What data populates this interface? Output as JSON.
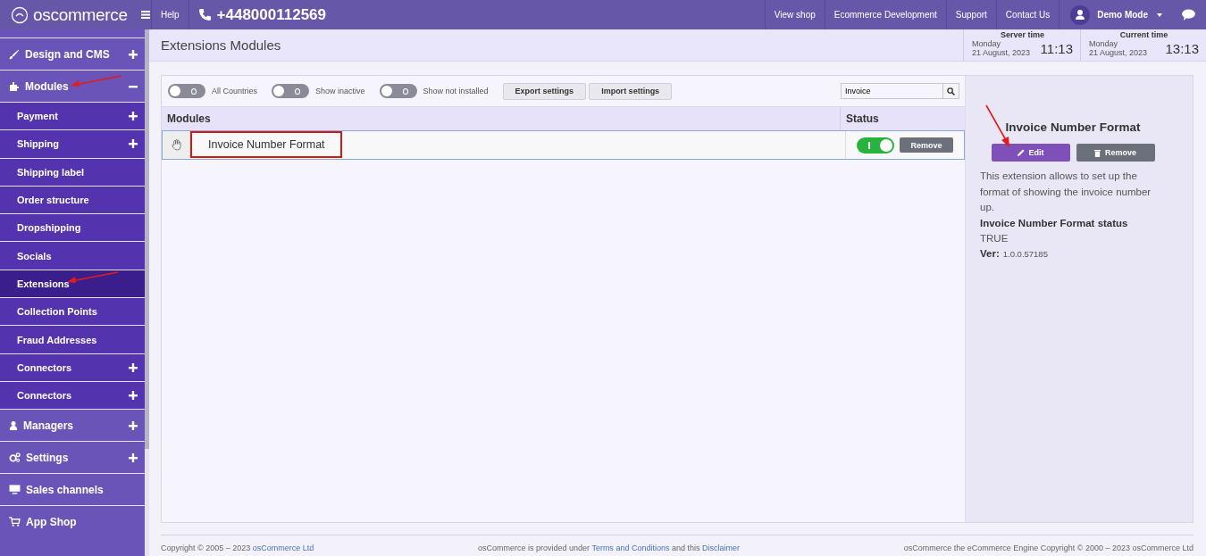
{
  "topbar": {
    "logo": "oscommerce",
    "help": "Help",
    "phone": "+448000112569",
    "links": [
      "View shop",
      "Ecommerce Development",
      "Support",
      "Contact Us"
    ],
    "user": "Demo Mode"
  },
  "sidebar": {
    "items": [
      {
        "label": "Design and CMS",
        "kind": "section",
        "expanded": false,
        "selected": false,
        "pointer_arrow": false
      },
      {
        "label": "Modules",
        "kind": "section",
        "expanded": true,
        "selected": false,
        "pointer_arrow": true
      },
      {
        "label": "Payment",
        "kind": "sub",
        "expanded": false,
        "selected": false,
        "pointer_arrow": false
      },
      {
        "label": "Shipping",
        "kind": "sub",
        "expanded": false,
        "selected": false,
        "pointer_arrow": false
      },
      {
        "label": "Shipping label",
        "kind": "sub",
        "selected": false,
        "pointer_arrow": false
      },
      {
        "label": "Order structure",
        "kind": "sub",
        "selected": false,
        "pointer_arrow": false
      },
      {
        "label": "Dropshipping",
        "kind": "sub",
        "selected": false,
        "pointer_arrow": false
      },
      {
        "label": "Socials",
        "kind": "sub",
        "selected": false,
        "pointer_arrow": false
      },
      {
        "label": "Extensions",
        "kind": "sub",
        "selected": true,
        "pointer_arrow": true
      },
      {
        "label": "Collection Points",
        "kind": "sub",
        "selected": false,
        "pointer_arrow": false
      },
      {
        "label": "Fraud Addresses",
        "kind": "sub",
        "selected": false,
        "pointer_arrow": false
      },
      {
        "label": "Connectors",
        "kind": "sub",
        "expanded": false,
        "selected": false,
        "pointer_arrow": false
      },
      {
        "label": "Connectors",
        "kind": "sub",
        "expanded": false,
        "selected": false,
        "pointer_arrow": false
      },
      {
        "label": "Managers",
        "kind": "section",
        "expanded": false,
        "selected": false,
        "pointer_arrow": false
      },
      {
        "label": "Settings",
        "kind": "section",
        "expanded": false,
        "selected": false,
        "pointer_arrow": false
      },
      {
        "label": "Sales channels",
        "kind": "section",
        "selected": false,
        "pointer_arrow": false
      },
      {
        "label": "App Shop",
        "kind": "section",
        "selected": false,
        "pointer_arrow": false
      }
    ]
  },
  "page_title": "Extensions Modules",
  "times": [
    {
      "label": "Server time",
      "day": "Monday",
      "date": "21 August, 2023",
      "time": "11:13"
    },
    {
      "label": "Current time",
      "day": "Monday",
      "date": "21 August, 2023",
      "time": "13:13"
    }
  ],
  "filters": [
    {
      "label": "All Countries",
      "on": false
    },
    {
      "label": "Show inactive",
      "on": false
    },
    {
      "label": "Show not installed",
      "on": false
    }
  ],
  "toolbar_buttons": [
    "Export settings",
    "Import settings"
  ],
  "search": {
    "value": "Invoice"
  },
  "table": {
    "columns": [
      "Modules",
      "Status"
    ],
    "rows": [
      {
        "name": "Invoice Number Format",
        "on": true,
        "highlighted": true,
        "action": "Remove"
      }
    ]
  },
  "details": {
    "title": "Invoice Number Format",
    "edit": "Edit",
    "edit_pointer_arrow": true,
    "remove": "Remove",
    "description": "This extension allows to set up the format of showing the invoice number up.",
    "status_label": "Invoice Number Format status",
    "status_value": "TRUE",
    "version_label": "Ver:",
    "version": "1.0.0.57185"
  },
  "footer": {
    "left": {
      "text": "Copyright © 2005 – 2023",
      "link": "osCommerce Ltd"
    },
    "center": {
      "text1": "osCommerce is provided under",
      "link1": "Terms and Conditions",
      "text2": "and this",
      "link2": "Disclaimer"
    },
    "right": "osCommerce the eCommerce Engine Copyright © 2000 – 2023 osCommerce Ltd"
  }
}
